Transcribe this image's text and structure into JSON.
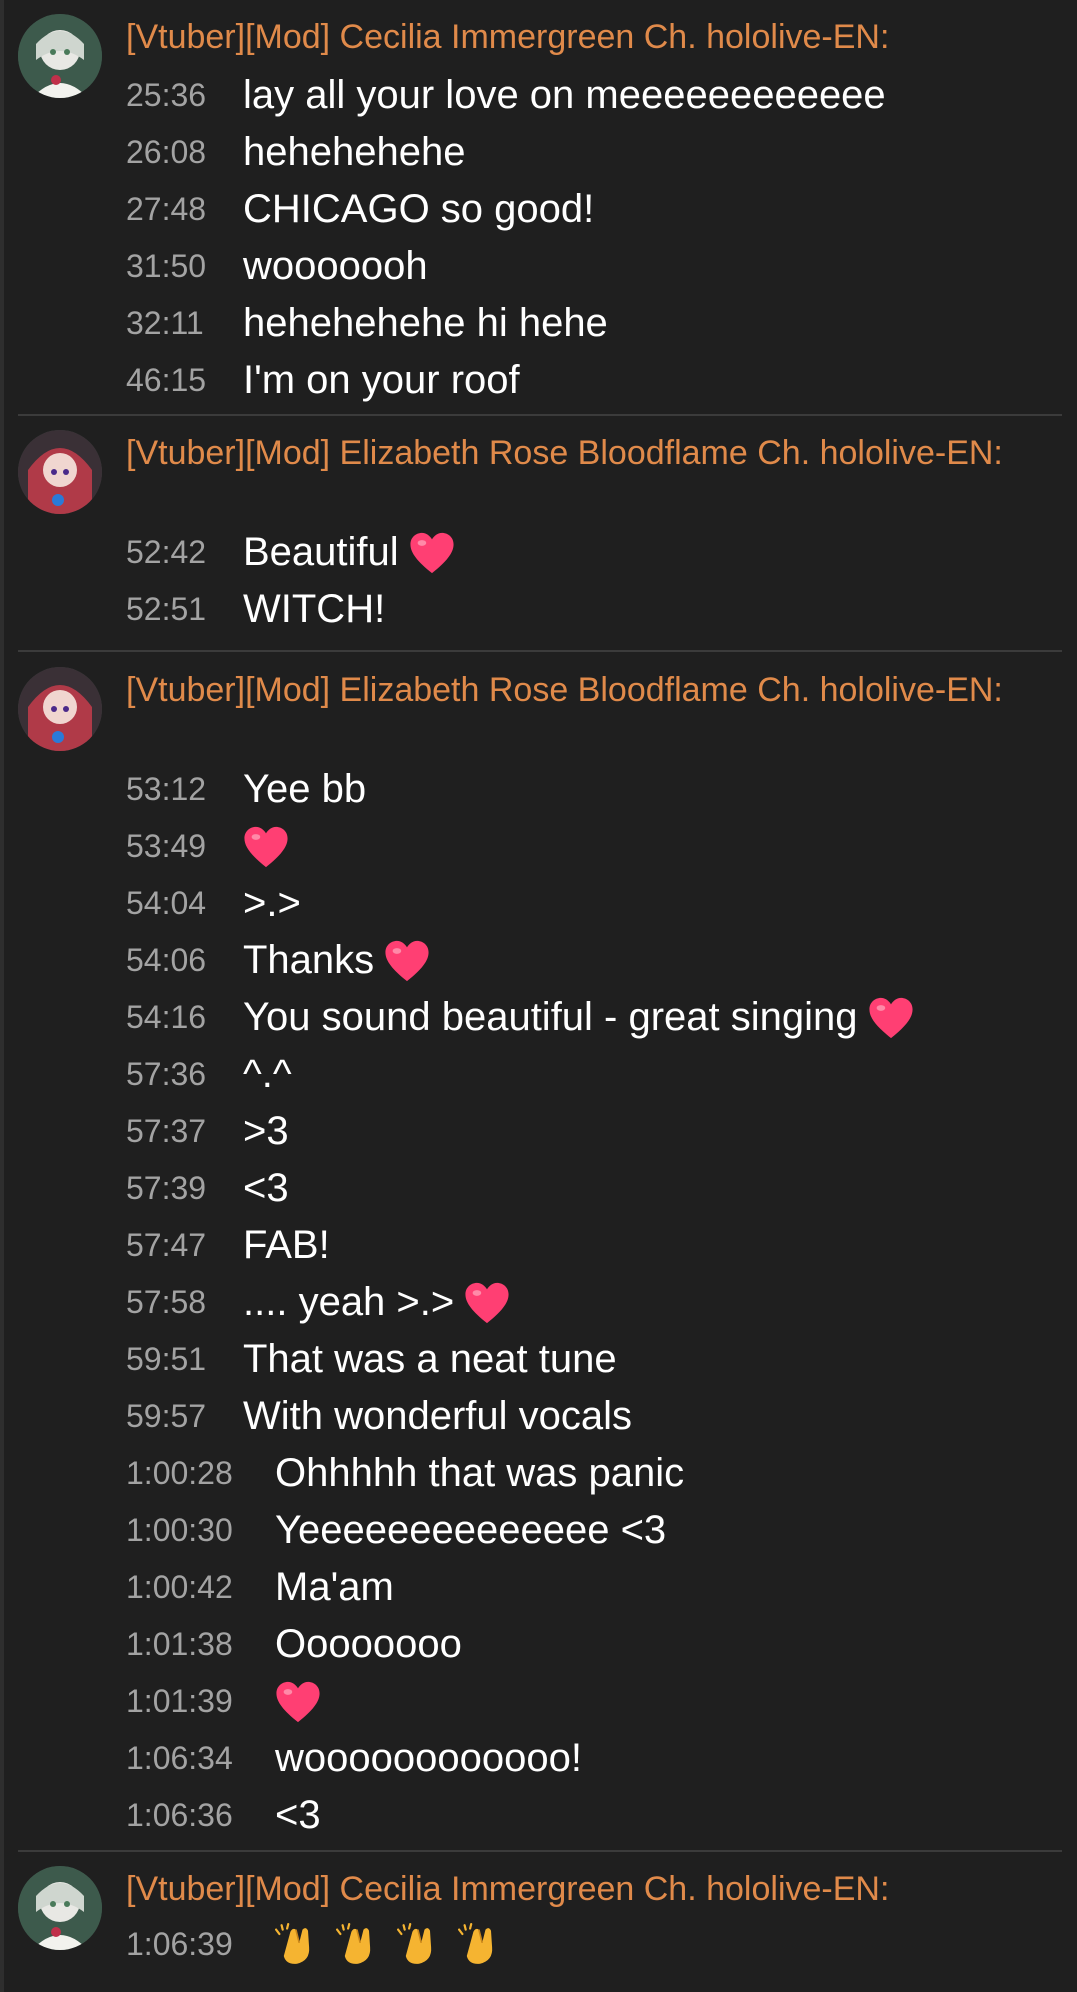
{
  "groups": [
    {
      "author": "[Vtuber][Mod] Cecilia Immergreen Ch. hololive-EN:",
      "avatar": "cecilia-avatar",
      "messages": [
        {
          "time": "25:36",
          "text": "lay all your love on meeeeeeeeeeee"
        },
        {
          "time": "26:08",
          "text": "hehehehehe"
        },
        {
          "time": "27:48",
          "text": "CHICAGO so good!"
        },
        {
          "time": "31:50",
          "text": "wooooooh"
        },
        {
          "time": "32:11",
          "text": "hehehehehe hi hehe"
        },
        {
          "time": "46:15",
          "text": "I'm on your roof"
        }
      ]
    },
    {
      "author": "[Vtuber][Mod] Elizabeth Rose Bloodflame Ch. hololive-EN:",
      "avatar": "elizabeth-avatar",
      "messages": [
        {
          "time": "52:42",
          "text": "Beautiful",
          "emoji": "heart-icon"
        },
        {
          "time": "52:51",
          "text": "WITCH!"
        }
      ]
    },
    {
      "author": "[Vtuber][Mod] Elizabeth Rose Bloodflame Ch. hololive-EN:",
      "avatar": "elizabeth-avatar",
      "messages": [
        {
          "time": "53:12",
          "text": "Yee bb"
        },
        {
          "time": "53:49",
          "text": "",
          "emoji": "heart-icon"
        },
        {
          "time": "54:04",
          "text": ">.>"
        },
        {
          "time": "54:06",
          "text": "Thanks",
          "emoji": "heart-icon"
        },
        {
          "time": "54:16",
          "text": "You sound beautiful - great singing",
          "emoji": "heart-icon"
        },
        {
          "time": "57:36",
          "text": "^.^"
        },
        {
          "time": "57:37",
          "text": ">3"
        },
        {
          "time": "57:39",
          "text": "<3"
        },
        {
          "time": "57:47",
          "text": "FAB!"
        },
        {
          "time": "57:58",
          "text": ".... yeah >.>",
          "emoji": "heart-icon"
        },
        {
          "time": "59:51",
          "text": "That was a neat tune"
        },
        {
          "time": "59:57",
          "text": "With wonderful vocals"
        },
        {
          "time": "1:00:28",
          "text": "Ohhhhh that was panic"
        },
        {
          "time": "1:00:30",
          "text": "Yeeeeeeeeeeeeee <3"
        },
        {
          "time": "1:00:42",
          "text": "Ma'am"
        },
        {
          "time": "1:01:38",
          "text": "Oooooooo"
        },
        {
          "time": "1:01:39",
          "text": "",
          "emoji": "heart-icon"
        },
        {
          "time": "1:06:34",
          "text": "woooooooooooo!"
        },
        {
          "time": "1:06:36",
          "text": "<3"
        }
      ]
    },
    {
      "author": "[Vtuber][Mod] Cecilia Immergreen Ch. hololive-EN:",
      "avatar": "cecilia-avatar",
      "messages": [
        {
          "time": "1:06:39",
          "text": "",
          "emoji": "clapping-hands-icon",
          "emoji_count": 4
        }
      ]
    }
  ],
  "colors": {
    "background": "#1f1f1f",
    "author": "#e08a4a",
    "timestamp": "#a3a3a3",
    "text": "#ffffff",
    "heart": "#ff3f73",
    "divider": "#3b3b3b"
  }
}
